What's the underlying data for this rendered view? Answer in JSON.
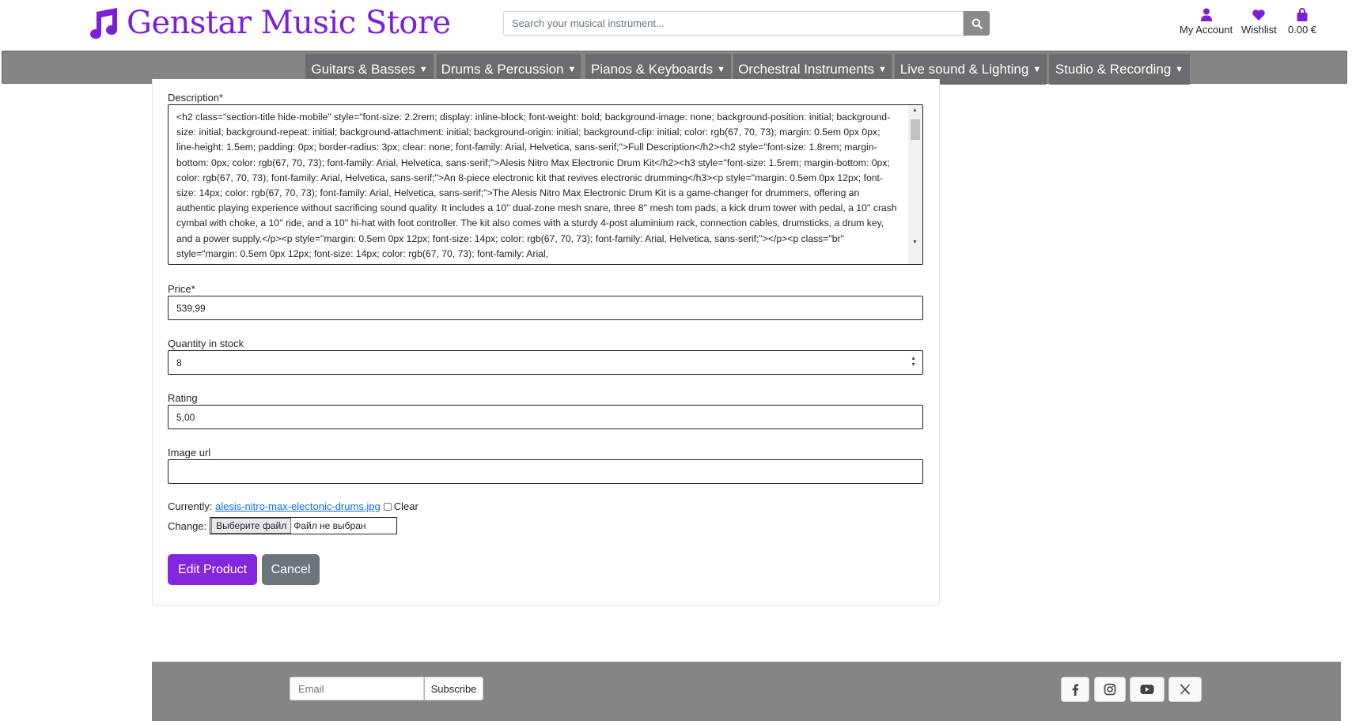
{
  "header": {
    "store_name": "Genstar Music Store",
    "search_placeholder": "Search your musical instrument...",
    "account_label": "My Account",
    "wishlist_label": "Wishlist",
    "cart_total": "0.00 €"
  },
  "nav": {
    "items": [
      {
        "label": "Guitars & Basses"
      },
      {
        "label": "Drums & Percussion"
      },
      {
        "label": "Pianos & Keyboards"
      },
      {
        "label": "Orchestral Instruments"
      },
      {
        "label": "Live sound & Lighting"
      },
      {
        "label": "Studio & Recording"
      }
    ]
  },
  "form": {
    "description_label": "Description*",
    "description_value": "<h2 class=\"section-title hide-mobile\" style=\"font-size: 2.2rem; display: inline-block; font-weight: bold; background-image: none; background-position: initial; background-size: initial; background-repeat: initial; background-attachment: initial; background-origin: initial; background-clip: initial; color: rgb(67, 70, 73); margin: 0.5em 0px 0px; line-height: 1.5em; padding: 0px; border-radius: 3px; clear: none; font-family: Arial, Helvetica, sans-serif;\">Full Description</h2><h2 style=\"font-size: 1.8rem; margin-bottom: 0px; color: rgb(67, 70, 73); font-family: Arial, Helvetica, sans-serif;\">Alesis Nitro Max Electronic Drum Kit</h2><h3 style=\"font-size: 1.5rem; margin-bottom: 0px; color: rgb(67, 70, 73); font-family: Arial, Helvetica, sans-serif;\">An 8-piece electronic kit that revives electronic drumming</h3><p style=\"margin: 0.5em 0px 12px; font-size: 14px; color: rgb(67, 70, 73); font-family: Arial, Helvetica, sans-serif;\">The Alesis Nitro Max Electronic Drum Kit is a game-changer for drummers, offering an authentic playing experience without sacrificing sound quality. It includes a 10'' dual-zone mesh snare, three 8'' mesh tom pads, a kick drum tower with pedal, a 10'' crash cymbal with choke, a 10'' ride, and a 10'' hi-hat with foot controller. The kit also comes with a sturdy 4-post aluminium rack, connection cables, drumsticks, a drum key, and a power supply.</p><p style=\"margin: 0.5em 0px 12px; font-size: 14px; color: rgb(67, 70, 73); font-family: Arial, Helvetica, sans-serif;\"></p><p class=\"br\" style=\"margin: 0.5em 0px 12px; font-size: 14px; color: rgb(67, 70, 73); font-family: Arial,",
    "price_label": "Price*",
    "price_value": "539,99",
    "quantity_label": "Quantity in stock",
    "quantity_value": "8",
    "rating_label": "Rating",
    "rating_value": "5,00",
    "image_url_label": "Image url",
    "image_url_value": "",
    "currently_label": "Currently:",
    "currently_file": "alesis-nitro-max-electonic-drums.jpg",
    "clear_label": "Clear",
    "change_label": "Change:",
    "choose_file_label": "Выберите файл",
    "no_file_label": "Файл не выбран",
    "submit_label": "Edit Product",
    "cancel_label": "Cancel"
  },
  "footer": {
    "email_placeholder": "Email",
    "subscribe_label": "Subscribe"
  },
  "colors": {
    "brand": "#7d1fd9",
    "button_primary": "#8425e0",
    "nav_bg": "#858585",
    "nav_item_bg": "#6d6a70"
  }
}
